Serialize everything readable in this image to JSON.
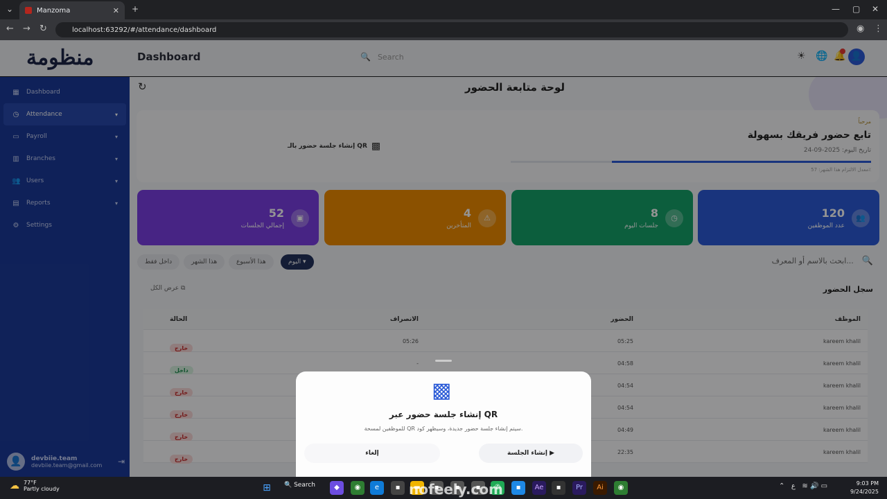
{
  "browser": {
    "tab_title": "Manzoma",
    "url": "localhost:63292/#/attendance/dashboard"
  },
  "header": {
    "logo": "منظومة",
    "page_title": "Dashboard",
    "search_placeholder": "Search"
  },
  "sidebar": {
    "items": [
      {
        "label": "Dashboard",
        "icon": "grid-icon"
      },
      {
        "label": "Attendance",
        "icon": "clock-icon"
      },
      {
        "label": "Payroll",
        "icon": "card-icon"
      },
      {
        "label": "Branches",
        "icon": "building-icon"
      },
      {
        "label": "Users",
        "icon": "users-icon"
      },
      {
        "label": "Reports",
        "icon": "chart-icon"
      },
      {
        "label": "Settings",
        "icon": "gear-icon"
      }
    ],
    "user": {
      "name": "devbiie.team",
      "email": "devbiie.team@gmail.com"
    }
  },
  "main": {
    "title": "لوحة متابعة الحضور",
    "welcome": {
      "hello": "مرحباً",
      "headline": "تابع حضور فريقك بسهولة",
      "date_label": "تاريخ اليوم: 2025-09-24",
      "rate_label": "معدل الالتزام هذا الشهر: 57٪",
      "progress": 0.72,
      "qr_button": "إنشاء جلسة حضور بالـ QR"
    },
    "stats": [
      {
        "value": "120",
        "label": "عدد الموظفين",
        "color": "#2b5bd7"
      },
      {
        "value": "8",
        "label": "جلسات اليوم",
        "color": "#16a36a"
      },
      {
        "value": "4",
        "label": "المتأخرين",
        "color": "#f08c00"
      },
      {
        "value": "52",
        "label": "إجمالي الجلسات",
        "color": "#7b3fe4"
      }
    ],
    "search_placeholder": "ابحث بالاسم أو المعرف...",
    "filters": [
      "اليوم",
      "هذا الأسبوع",
      "هذا الشهر",
      "داخل فقط"
    ],
    "log_title": "سجل الحضور",
    "view_all": "عرض الكل",
    "table": {
      "headers": {
        "name": "الموظف",
        "in": "الحضور",
        "out": "الانصراف",
        "status": "الحالة"
      },
      "rows": [
        {
          "name": "kareem khalil",
          "in": "05:25",
          "out": "05:26",
          "status": "خارج"
        },
        {
          "name": "kareem khalil",
          "in": "04:58",
          "out": "-",
          "status": "داخل"
        },
        {
          "name": "kareem khalil",
          "in": "04:54",
          "out": "",
          "status": "خارج"
        },
        {
          "name": "kareem khalil",
          "in": "04:54",
          "out": "",
          "status": "خارج"
        },
        {
          "name": "kareem khalil",
          "in": "04:49",
          "out": "",
          "status": "خارج"
        },
        {
          "name": "kareem khalil",
          "in": "22:35",
          "out": "",
          "status": "خارج"
        }
      ]
    }
  },
  "modal": {
    "title": "إنشاء جلسة حضور عبر QR",
    "desc": "للموظفين لمسحة QR سيتم إنشاء جلسة حضور جديدة، وسيظهر كود.",
    "create": "إنشاء الجلسة",
    "cancel": "إلغاء"
  },
  "taskbar": {
    "temp": "77°F",
    "weather": "Partly cloudy",
    "search": "Search",
    "time": "9:03 PM",
    "date": "9/24/2025",
    "watermark": "nofeely.com"
  }
}
